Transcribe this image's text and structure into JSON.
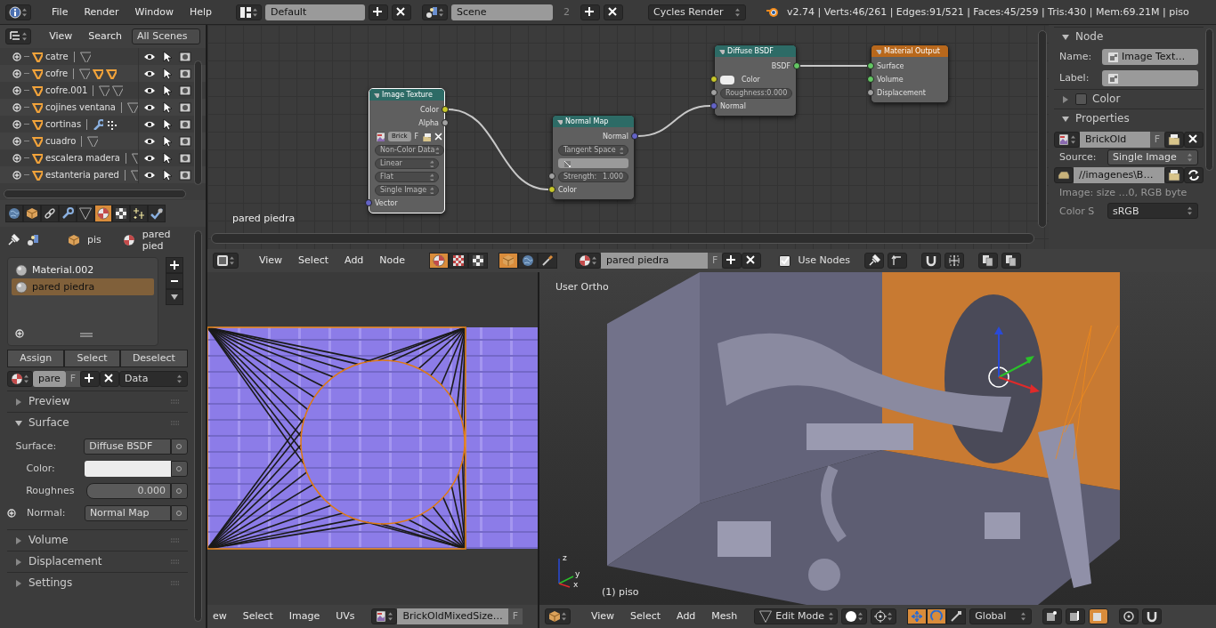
{
  "top_bar": {
    "menus": [
      "File",
      "Render",
      "Window",
      "Help"
    ],
    "screen_layout": "Default",
    "scene": "Scene",
    "scene_users": "2",
    "render_engine": "Cycles Render",
    "stats": "v2.74 | Verts:46/261 | Edges:91/521 | Faces:45/259 | Tris:430 | Mem:69.21M | piso"
  },
  "outliner": {
    "menus": [
      "View",
      "Search"
    ],
    "display_mode": "All Scenes",
    "items": [
      {
        "name": "catre",
        "data_icons": [
          {
            "kind": "mesh"
          }
        ]
      },
      {
        "name": "cofre",
        "data_icons": [
          {
            "kind": "mesh"
          },
          {
            "kind": "child"
          },
          {
            "kind": "child"
          }
        ]
      },
      {
        "name": "cofre.001",
        "data_icons": [
          {
            "kind": "mesh"
          },
          {
            "kind": "mesh"
          }
        ]
      },
      {
        "name": "cojines ventana",
        "data_icons": [
          {
            "kind": "mesh"
          }
        ]
      },
      {
        "name": "cortinas",
        "data_icons": [
          {
            "kind": "modifier"
          },
          {
            "kind": "vertex_groups"
          }
        ]
      },
      {
        "name": "cuadro",
        "data_icons": [
          {
            "kind": "mesh"
          }
        ]
      },
      {
        "name": "escalera madera",
        "data_icons": [
          {
            "kind": "mesh"
          }
        ]
      },
      {
        "name": "estanteria pared",
        "data_icons": [
          {
            "kind": "mesh"
          }
        ]
      }
    ]
  },
  "properties": {
    "tabs": [
      {
        "kind": "world",
        "selected": false
      },
      {
        "kind": "object",
        "selected": false
      },
      {
        "kind": "constraints",
        "selected": false
      },
      {
        "kind": "modifiers",
        "selected": false
      },
      {
        "kind": "data",
        "selected": false
      },
      {
        "kind": "material",
        "selected": true
      },
      {
        "kind": "texture",
        "selected": false
      },
      {
        "kind": "particles",
        "selected": false
      },
      {
        "kind": "physics",
        "selected": false
      }
    ],
    "breadcrumb": [
      "pis",
      "pared pied"
    ],
    "material_slots": [
      {
        "name": "Material.002",
        "selected": false
      },
      {
        "name": "pared piedra",
        "selected": true
      }
    ],
    "slot_buttons": [
      "Assign",
      "Select",
      "Deselect"
    ],
    "material_name": "pare",
    "fake_user": "F",
    "link": "Data",
    "panels": [
      {
        "title": "Preview",
        "expanded": false
      },
      {
        "title": "Surface",
        "expanded": true,
        "rows": [
          {
            "kind": "dropdown",
            "label": "Surface:",
            "value": "Diffuse BSDF"
          },
          {
            "kind": "color",
            "label": "Color:",
            "color": "#ececec"
          },
          {
            "kind": "number",
            "label": "Roughnes",
            "value": "0.000"
          },
          {
            "kind": "dropdown",
            "label": "Normal:",
            "value": "Normal Map",
            "expandable": true
          }
        ]
      },
      {
        "title": "Volume",
        "expanded": false
      },
      {
        "title": "Displacement",
        "expanded": false
      },
      {
        "title": "Settings",
        "expanded": false
      }
    ]
  },
  "node_editor": {
    "material_label": "pared piedra",
    "nodes": [
      {
        "title": "Image Texture",
        "color": "#2d6b66",
        "selected": true,
        "items": [
          {
            "kind": "output",
            "label": "Color",
            "color": "#c7c729"
          },
          {
            "kind": "output",
            "label": "Alpha",
            "color": "#a1a1a1"
          },
          {
            "kind": "image",
            "value": "Brick",
            "fake_user": "F"
          },
          {
            "kind": "dropdown",
            "value": "Non-Color Data"
          },
          {
            "kind": "dropdown",
            "value": "Linear"
          },
          {
            "kind": "dropdown",
            "value": "Flat"
          },
          {
            "kind": "dropdown",
            "value": "Single Image"
          },
          {
            "kind": "input",
            "label": "Vector",
            "color": "#6363c7"
          }
        ]
      },
      {
        "title": "Normal Map",
        "color": "#2d6b66",
        "selected": false,
        "items": [
          {
            "kind": "output",
            "label": "Normal",
            "color": "#6363c7"
          },
          {
            "kind": "dropdown",
            "value": "Tangent Space"
          },
          {
            "kind": "uv_field"
          },
          {
            "kind": "number",
            "label": "Strength:",
            "value": "1.000",
            "color": "#a1a1a1"
          },
          {
            "kind": "input",
            "label": "Color",
            "color": "#c7c729"
          }
        ]
      },
      {
        "title": "Diffuse BSDF",
        "color": "#2d6b66",
        "selected": false,
        "items": [
          {
            "kind": "output",
            "label": "BSDF",
            "color": "#63c763"
          },
          {
            "kind": "color_input",
            "label": "Color",
            "color": "#c7c729"
          },
          {
            "kind": "number",
            "label": "Roughness:",
            "value": "0.000",
            "color": "#a1a1a1"
          },
          {
            "kind": "input",
            "label": "Normal",
            "color": "#6363c7"
          }
        ]
      },
      {
        "title": "Material Output",
        "color": "#b8681c",
        "selected": false,
        "items": [
          {
            "kind": "input",
            "label": "Surface",
            "color": "#63c763"
          },
          {
            "kind": "input",
            "label": "Volume",
            "color": "#63c763"
          },
          {
            "kind": "input",
            "label": "Displacement",
            "color": "#a1a1a1"
          }
        ]
      }
    ]
  },
  "node_panel": {
    "node": {
      "title": "Node",
      "expanded": true,
      "name_label": "Name:",
      "name": "Image Text…",
      "label_label": "Label:"
    },
    "color": {
      "title": "Color",
      "expanded": false,
      "checked": false
    },
    "properties": {
      "title": "Properties",
      "expanded": true,
      "image": "BrickOld",
      "fake_user": "F",
      "source_label": "Source:",
      "source": "Single Image",
      "filepath": "//imagenes\\B…",
      "info": "Image: size …0, RGB byte",
      "color_space_label": "Color S",
      "color_space": "sRGB"
    }
  },
  "node_header": {
    "menus": [
      "View",
      "Select",
      "Add",
      "Node"
    ],
    "shader_types": [
      {
        "selected": true
      },
      {
        "selected": false
      },
      {
        "selected": false
      }
    ],
    "shader_sources": [
      {
        "selected": true
      },
      {
        "selected": false
      },
      {
        "selected": false
      }
    ],
    "material": "pared piedra",
    "fake_user": "F",
    "use_nodes": {
      "label": "Use Nodes",
      "checked": true
    }
  },
  "uv_editor": {
    "menus": [
      "ew",
      "Select",
      "Image",
      "UVs"
    ],
    "image": "BrickOldMixedSize…",
    "fake_user": "F"
  },
  "viewport": {
    "view_name": "User Ortho",
    "object_info": "(1) piso",
    "axis_labels": [
      "x",
      "y",
      "z"
    ],
    "menus": [
      "View",
      "Select",
      "Add",
      "Mesh"
    ],
    "mode": "Edit Mode",
    "orientation": "Global",
    "manipulators": [
      {
        "selected": true
      },
      {
        "selected": true
      },
      {
        "selected": false
      }
    ]
  }
}
